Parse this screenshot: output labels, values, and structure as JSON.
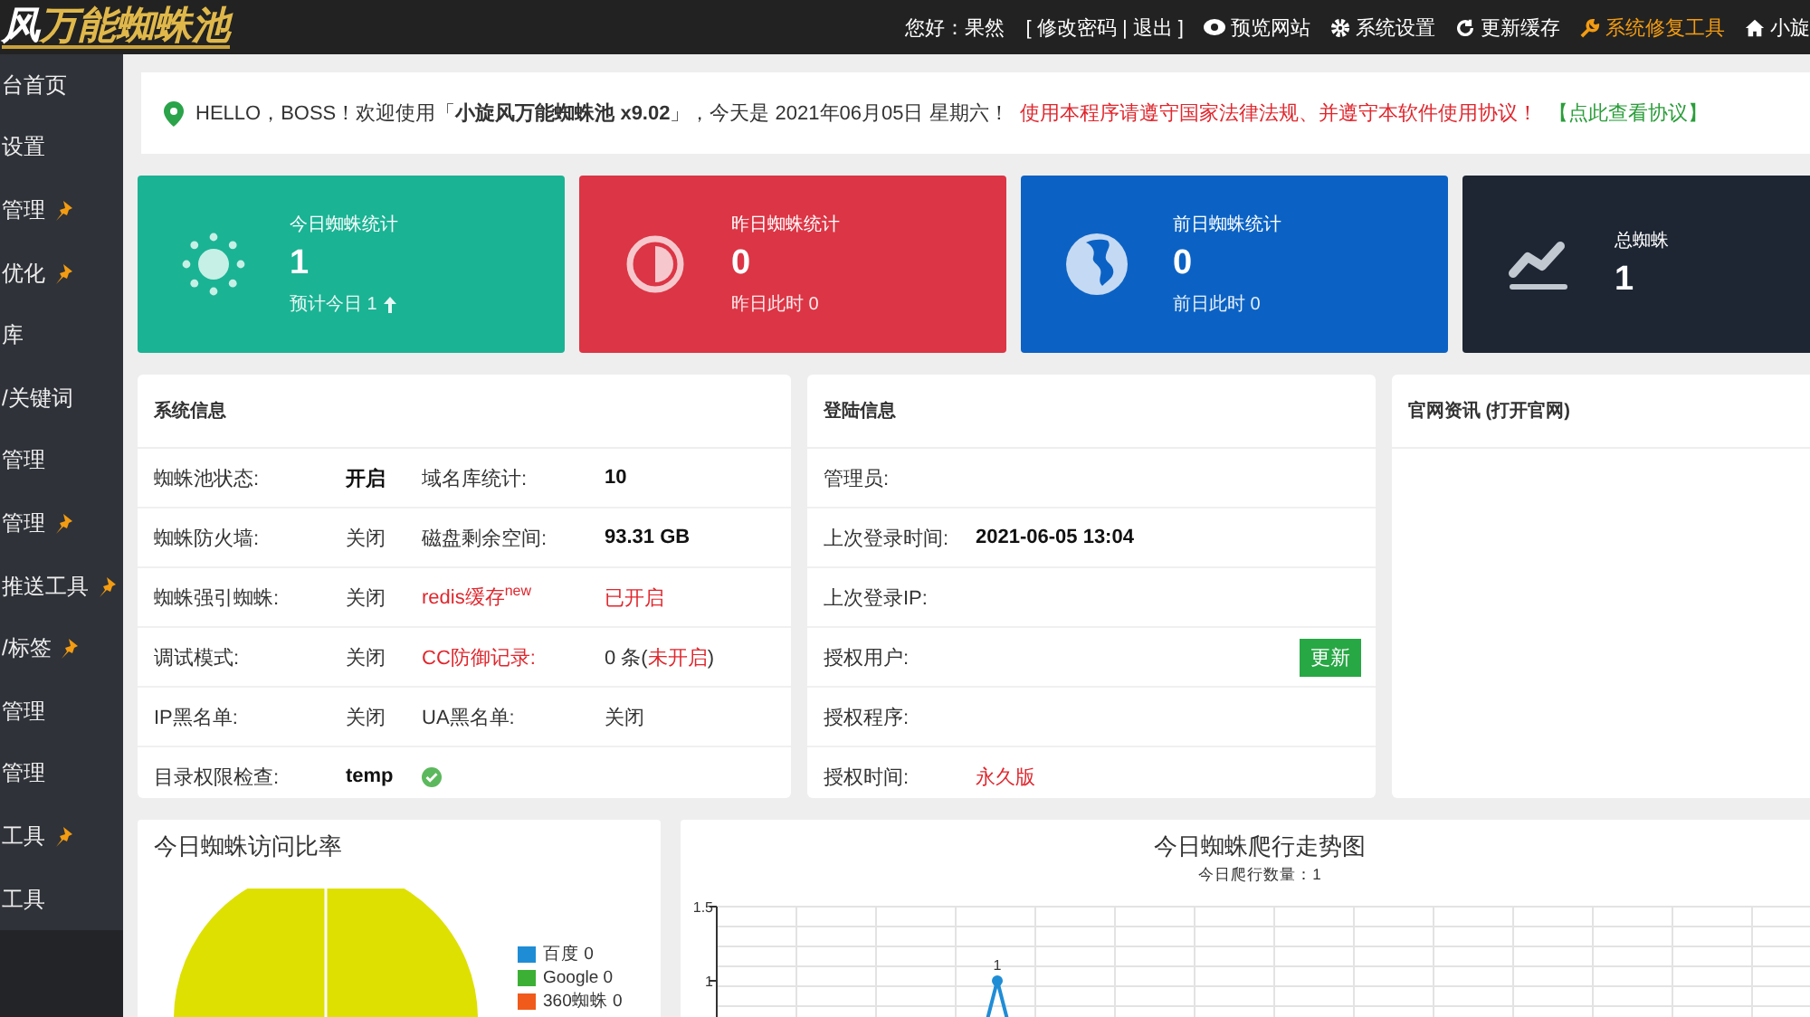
{
  "header": {
    "logo": [
      "风",
      "万能蜘蛛池"
    ],
    "greeting": "您好：果然",
    "account_links": "[ 修改密码 | 退出 ]",
    "links": [
      {
        "kind": "eye",
        "label": "预览网站",
        "highlight": false
      },
      {
        "kind": "gear",
        "label": "系统设置",
        "highlight": false
      },
      {
        "kind": "refresh",
        "label": "更新缓存",
        "highlight": false
      },
      {
        "kind": "wrench",
        "label": "系统修复工具",
        "highlight": true
      },
      {
        "kind": "home",
        "label": "小旋",
        "highlight": false
      }
    ]
  },
  "sidebar": {
    "items": [
      {
        "label": "台首页",
        "pinned": false
      },
      {
        "label": "设置",
        "pinned": false
      },
      {
        "label": "管理",
        "pinned": true
      },
      {
        "label": "优化",
        "pinned": true
      },
      {
        "label": "库",
        "pinned": false
      },
      {
        "label": "/关键词",
        "pinned": false
      },
      {
        "label": "管理",
        "pinned": false
      },
      {
        "label": "管理",
        "pinned": true
      },
      {
        "label": "推送工具",
        "pinned": true
      },
      {
        "label": "/标签",
        "pinned": true
      },
      {
        "label": "管理",
        "pinned": false
      },
      {
        "label": "管理",
        "pinned": false
      },
      {
        "label": "工具",
        "pinned": true
      },
      {
        "label": "工具",
        "pinned": false
      }
    ]
  },
  "notice": {
    "welcome": "HELLO，BOSS！欢迎使用「**小旋风万能蜘蛛池 x9.02**」，今天是 2021年06月05日 星期六！",
    "warning": "使用本程序请遵守国家法律法规、并遵守本软件使用协议！",
    "link": "【点此查看协议】"
  },
  "stats": [
    {
      "kind": "sun",
      "color": "#1ab394",
      "title": "今日蜘蛛统计",
      "value": "1",
      "sub": "预计今日 1",
      "rising": true
    },
    {
      "kind": "half-circle",
      "color": "#dc3545",
      "title": "昨日蜘蛛统计",
      "value": "0",
      "sub": "昨日此时 0",
      "rising": false
    },
    {
      "kind": "globe",
      "color": "#0b62c4",
      "title": "前日蜘蛛统计",
      "value": "0",
      "sub": "前日此时 0",
      "rising": false
    },
    {
      "kind": "trend",
      "color": "#1e2633",
      "title": "总蜘蛛",
      "value": "1",
      "rising": false
    }
  ],
  "system_info": {
    "title": "系统信息",
    "rows": [
      {
        "label": "蜘蛛池状态:",
        "value": "开启",
        "emphasized": true,
        "label2": "域名库统计:",
        "label2_alert": false,
        "value2": [
          {
            "text": "10",
            "alert": false
          }
        ],
        "value2_emphasized": true
      },
      {
        "label": "蜘蛛防火墙:",
        "value": "关闭",
        "emphasized": false,
        "label2": "磁盘剩余空间:",
        "label2_alert": false,
        "value2": [
          {
            "text": "93.31 GB",
            "alert": false
          }
        ],
        "value2_emphasized": true
      },
      {
        "label": "蜘蛛强引蜘蛛:",
        "value": "关闭",
        "emphasized": false,
        "label2": "redis缓存$^{new}$",
        "label2_alert": true,
        "value2": [
          {
            "text": "已开启",
            "alert": true
          }
        ],
        "value2_emphasized": false
      },
      {
        "label": "调试模式:",
        "value": "关闭",
        "emphasized": false,
        "label2": "CC防御记录:",
        "label2_alert": true,
        "value2": [
          {
            "text": "0 条(",
            "alert": false
          },
          {
            "text": "未开启",
            "alert": true
          },
          {
            "text": ")",
            "alert": false
          }
        ],
        "value2_emphasized": false
      },
      {
        "label": "IP黑名单:",
        "value": "关闭",
        "emphasized": false,
        "label2": "UA黑名单:",
        "label2_alert": false,
        "value2": [
          {
            "text": "关闭",
            "alert": false
          }
        ],
        "value2_emphasized": false
      },
      {
        "label": "目录权限检查:",
        "value": "temp",
        "emphasized": true,
        "verified": true
      }
    ]
  },
  "login_info": {
    "title": "登陆信息",
    "rows": [
      {
        "label": "管理员:"
      },
      {
        "label": "上次登录时间:",
        "value": "2021-06-05 13:04",
        "alert": false
      },
      {
        "label": "上次登录IP:"
      },
      {
        "label": "授权用户:",
        "button": "更新"
      },
      {
        "label": "授权程序:"
      },
      {
        "label": "授权时间:",
        "value": "永久版",
        "alert": true
      }
    ]
  },
  "news": {
    "title": "官网资讯 (打开官网)"
  },
  "pie_panel": {
    "title": "今日蜘蛛访问比率",
    "legend": [
      {
        "label": "百度 0",
        "color": "#1f8dd6"
      },
      {
        "label": "Google 0",
        "color": "#3cb034"
      },
      {
        "label": "360蜘蛛 0",
        "color": "#f05a1a"
      }
    ]
  },
  "line_panel": {
    "title": "今日蜘蛛爬行走势图",
    "subtitle": "今日爬行数量：1",
    "y_tick_labels": [
      "1.5",
      "1"
    ],
    "point_label": "1"
  }
}
